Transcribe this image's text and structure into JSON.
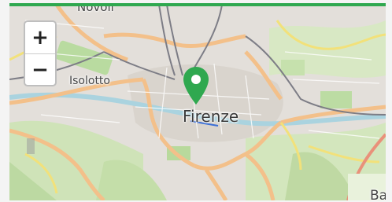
{
  "map": {
    "city_label": "Firenze",
    "place_labels": {
      "novoli": "Novoli",
      "isolotto": "Isolotto",
      "bagno": "Bag"
    },
    "marker": {
      "icon": "map-pin-icon",
      "color": "#2fa84f"
    },
    "accent_color": "#2fa84f"
  },
  "controls": {
    "zoom_in_label": "+",
    "zoom_out_label": "−"
  }
}
